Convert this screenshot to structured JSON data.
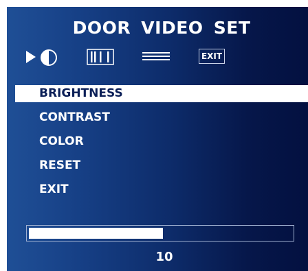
{
  "title": "DOOR  VIDEO  SET",
  "icons": {
    "play": "play-arrow-icon",
    "contrast": "half-circle-icon",
    "bars": "vertical-bars-icon",
    "lines": "horizontal-lines-icon",
    "exit_label": "EXIT"
  },
  "menu": {
    "items": [
      {
        "label": "BRIGHTNESS",
        "selected": true
      },
      {
        "label": "CONTRAST",
        "selected": false
      },
      {
        "label": "COLOR",
        "selected": false
      },
      {
        "label": "RESET",
        "selected": false
      },
      {
        "label": "EXIT",
        "selected": false
      }
    ]
  },
  "level": {
    "value": "10",
    "fraction": 0.51
  },
  "colors": {
    "background_left": "#1f4f96",
    "background_right": "#031040",
    "highlight": "#ffffff",
    "selected_text": "#0b1f57"
  }
}
